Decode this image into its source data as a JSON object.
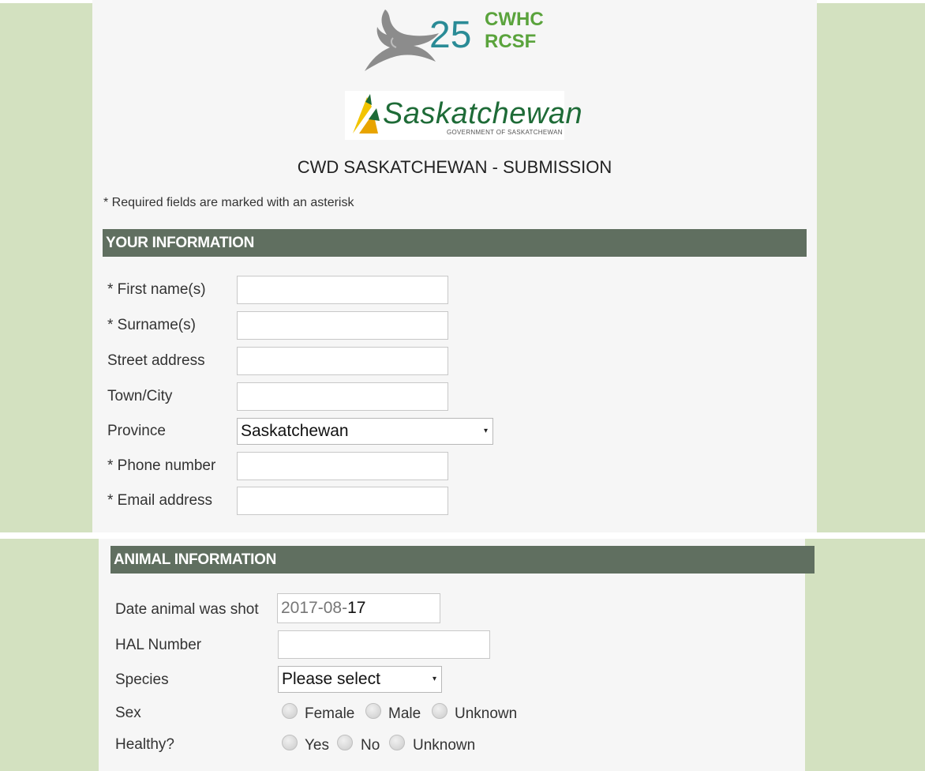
{
  "logos": {
    "cwhc_number": "25",
    "cwhc_line1": "CWHC",
    "cwhc_line2": "RCSF",
    "sk_wordmark": "Saskatchewan",
    "sk_subtext": "GOVERNMENT OF SASKATCHEWAN"
  },
  "form": {
    "title": "CWD SASKATCHEWAN - SUBMISSION",
    "required_note": "* Required fields are marked with an asterisk"
  },
  "your_information": {
    "heading": "YOUR INFORMATION",
    "fields": [
      {
        "label": "* First name(s)",
        "value": ""
      },
      {
        "label": "* Surname(s)",
        "value": ""
      },
      {
        "label": "Street address",
        "value": ""
      },
      {
        "label": "Town/City",
        "value": ""
      },
      {
        "label": "Province",
        "value": "Saskatchewan"
      },
      {
        "label": "* Phone number",
        "value": ""
      },
      {
        "label": "* Email address",
        "value": ""
      }
    ]
  },
  "animal_information": {
    "heading": "ANIMAL INFORMATION",
    "date_label": "Date animal was shot",
    "date_value": {
      "year": "2017",
      "sep1": "-",
      "month": "08",
      "sep2": "-",
      "day": "17"
    },
    "hal_label": "HAL Number",
    "hal_value": "",
    "species_label": "Species",
    "species_value": "Please select",
    "sex_label": "Sex",
    "sex_options": [
      "Female",
      "Male",
      "Unknown"
    ],
    "healthy_label": "Healthy?",
    "healthy_options": [
      "Yes",
      "No",
      "Unknown"
    ]
  },
  "colors": {
    "page_background": "#d3e1c0",
    "section_bar": "#606f60",
    "sk_green": "#1e6b37",
    "cwhc_teal": "#2a8b96",
    "cwhc_green": "#5aa33c"
  },
  "icons": {
    "cwhc_logo": "bird-logo",
    "sk_logo": "wheat-logo",
    "select_caret": "caret-down-icon",
    "radio": "radio-empty-icon"
  }
}
